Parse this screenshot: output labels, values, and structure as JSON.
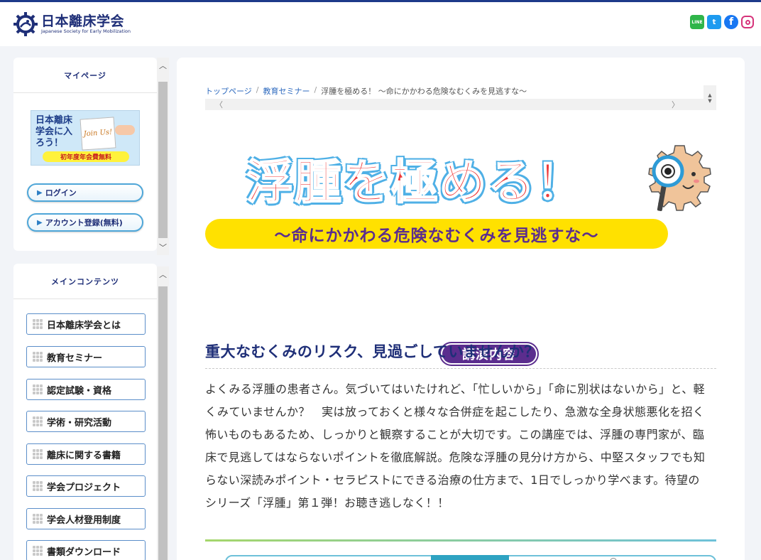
{
  "header": {
    "logo_ja": "日本離床学会",
    "logo_en": "Japanese Society for Early Mobilization",
    "social": {
      "line": "LINE",
      "twitter": "t",
      "facebook": "f"
    }
  },
  "mypage": {
    "title": "マイページ",
    "join": {
      "text": "日本離床学会に入ろう！",
      "card": "Join Us!",
      "free": "初年度年会費無料"
    },
    "login_label": "ログイン",
    "register_label": "アカウント登録(無料)"
  },
  "main_contents": {
    "title": "メインコンテンツ",
    "items": [
      {
        "label": "日本離床学会とは"
      },
      {
        "label": "教育セミナー"
      },
      {
        "label": "認定試験・資格"
      },
      {
        "label": "学術・研究活動"
      },
      {
        "label": "離床に関する書籍"
      },
      {
        "label": "学会プロジェクト"
      },
      {
        "label": "学会人材登用制度"
      },
      {
        "label": "書類ダウンロード"
      }
    ]
  },
  "breadcrumb": {
    "home": "トップページ",
    "seminar": "教育セミナー",
    "current": "浮腫を極める！ ～命にかかわる危険なむくみを見逃すな～",
    "sep": "/"
  },
  "hero": {
    "title": "浮腫を極める！",
    "subtitle": "～命にかかわる危険なむくみを見逃すな～",
    "badge": "講演内容"
  },
  "content": {
    "heading": "重大なむくみのリスク、見過ごしていませんか？",
    "body": "よくみる浮腫の患者さん。気づいてはいたけれど、「忙しいから」「命に別状はないから」と、軽くみていませんか？　実は放っておくと様々な合併症を起こしたり、急激な全身状態悪化を招く怖いものもあるため、しっかりと観察することが大切です。この講座では、浮腫の専門家が、臨床で見逃してはならないポイントを徹底解説。危険な浮腫の見分け方から、中堅スタッフでも知らない深読みポイント・セラピストにできる治療の仕方まで、1日でしっかり学べます。待望のシリーズ「浮腫」第１弾！お聴き逃しなく！！"
  },
  "colors": {
    "brand_navy": "#1f2f78",
    "accent_red": "#ee3a3a",
    "accent_yellow": "#ffe100",
    "accent_purple": "#5b2d8e",
    "outline_blue": "#4fb0e6"
  }
}
